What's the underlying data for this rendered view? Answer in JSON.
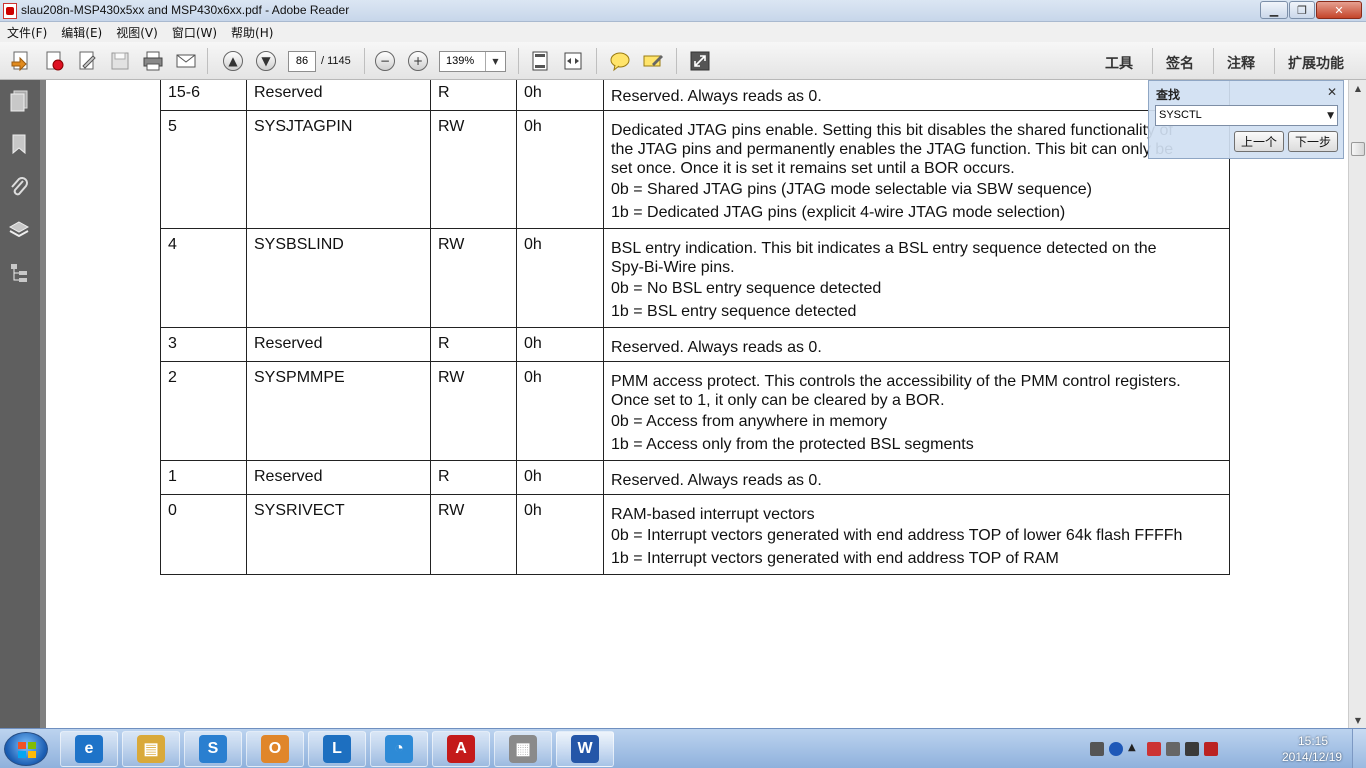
{
  "window": {
    "title": "slau208n-MSP430x5xx and MSP430x6xx.pdf - Adobe Reader"
  },
  "menu": [
    "文件(F)",
    "编辑(E)",
    "视图(V)",
    "窗口(W)",
    "帮助(H)"
  ],
  "toolbar": {
    "page_current": "86",
    "page_total": "/ 1145",
    "zoom": "139%",
    "right_tabs": [
      "工具",
      "签名",
      "注释",
      "扩展功能"
    ]
  },
  "find_panel": {
    "title": "查找",
    "query": "SYSCTL",
    "prev_label": "上一个",
    "next_label": "下一步"
  },
  "table": {
    "rows": [
      {
        "bit": "15-6",
        "field": "Reserved",
        "type": "R",
        "reset": "0h",
        "desc": [
          "Reserved. Always reads as 0."
        ],
        "options": []
      },
      {
        "bit": "5",
        "field": "SYSJTAGPIN",
        "type": "RW",
        "reset": "0h",
        "desc": [
          "Dedicated JTAG pins enable. Setting this bit disables the shared functionality of",
          "the JTAG pins and permanently enables the JTAG function. This bit can only be",
          "set once. Once it is set it remains set until a BOR occurs."
        ],
        "options": [
          "0b = Shared JTAG pins (JTAG mode selectable via SBW sequence)",
          "1b = Dedicated JTAG pins (explicit 4-wire JTAG mode selection)"
        ]
      },
      {
        "bit": "4",
        "field": "SYSBSLIND",
        "type": "RW",
        "reset": "0h",
        "desc": [
          "BSL entry indication. This bit indicates a BSL entry sequence detected on the",
          "Spy-Bi-Wire pins."
        ],
        "options": [
          "0b = No BSL entry sequence detected",
          "1b = BSL entry sequence detected"
        ]
      },
      {
        "bit": "3",
        "field": "Reserved",
        "type": "R",
        "reset": "0h",
        "desc": [
          "Reserved. Always reads as 0."
        ],
        "options": []
      },
      {
        "bit": "2",
        "field": "SYSPMMPE",
        "type": "RW",
        "reset": "0h",
        "desc": [
          "PMM access protect. This controls the accessibility of the PMM control registers.",
          "Once set to 1, it only can be cleared by a BOR."
        ],
        "options": [
          "0b = Access from anywhere in memory",
          "1b = Access only from the protected BSL segments"
        ]
      },
      {
        "bit": "1",
        "field": "Reserved",
        "type": "R",
        "reset": "0h",
        "desc": [
          "Reserved. Always reads as 0."
        ],
        "options": []
      },
      {
        "bit": "0",
        "field": "SYSRIVECT",
        "type": "RW",
        "reset": "0h",
        "desc": [
          "RAM-based interrupt vectors"
        ],
        "options": [
          "0b = Interrupt vectors generated with end address TOP of lower 64k flash FFFFh",
          "1b = Interrupt vectors generated with end address TOP of RAM"
        ]
      }
    ]
  },
  "taskbar": {
    "apps": [
      {
        "name": "ie",
        "glyph": "e",
        "color": "#1e73c8"
      },
      {
        "name": "explorer",
        "glyph": "▤",
        "color": "#d9a93a"
      },
      {
        "name": "sogou",
        "glyph": "S",
        "color": "#2a7fd0"
      },
      {
        "name": "outlook",
        "glyph": "O",
        "color": "#e0862a"
      },
      {
        "name": "lync",
        "glyph": "L",
        "color": "#1d6fc0"
      },
      {
        "name": "maxthon",
        "glyph": "◔",
        "color": "#2d8ad6"
      },
      {
        "name": "adobe-reader",
        "glyph": "A",
        "color": "#c41a1a"
      },
      {
        "name": "vmware",
        "glyph": "▦",
        "color": "#8a8a8a"
      },
      {
        "name": "word",
        "glyph": "W",
        "color": "#2456a8"
      }
    ],
    "time": "15:15",
    "date": "2014/12/19"
  }
}
